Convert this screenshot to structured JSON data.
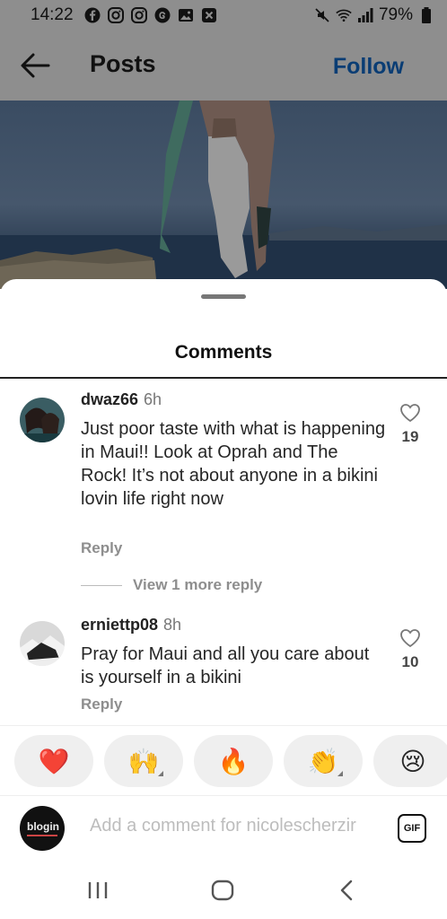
{
  "status_bar": {
    "time": "14:22",
    "battery": "79%",
    "left_icons": [
      "facebook-icon",
      "instagram-icon",
      "instagram-icon",
      "threads-icon",
      "gallery-icon",
      "close-box-icon"
    ],
    "right_icons": [
      "mute-icon",
      "wifi-icon",
      "signal-icon",
      "battery-icon"
    ]
  },
  "header": {
    "title": "Posts",
    "follow_label": "Follow"
  },
  "comments_sheet": {
    "title": "Comments",
    "comments": [
      {
        "username": "dwaz66",
        "time": "6h",
        "text": "Just poor taste with what is happening in Maui!! Look at Oprah and The Rock! It’s not about anyone in a bikini lovin life right now",
        "reply_label": "Reply",
        "likes": "19"
      },
      {
        "username": "erniettp08",
        "time": "8h",
        "text": "Pray for Maui and all you care about is yourself in a bikini",
        "reply_label": "Reply",
        "likes": "10"
      }
    ],
    "view_more_replies": "View 1 more reply"
  },
  "reactions": [
    {
      "emoji": "❤️",
      "name": "red-heart"
    },
    {
      "emoji": "🙌",
      "name": "raising-hands"
    },
    {
      "emoji": "🔥",
      "name": "fire"
    },
    {
      "emoji": "👏",
      "name": "clapping-hands"
    },
    {
      "emoji": "😢",
      "name": "crying-face"
    }
  ],
  "composer": {
    "placeholder": "Add a comment for nicolescherzir",
    "gif_label": "GIF",
    "avatar_text": "blogin"
  },
  "colors": {
    "overlay": "#8e8e8e",
    "follow": "#0a3d74",
    "heart_red": "#e0245e"
  }
}
